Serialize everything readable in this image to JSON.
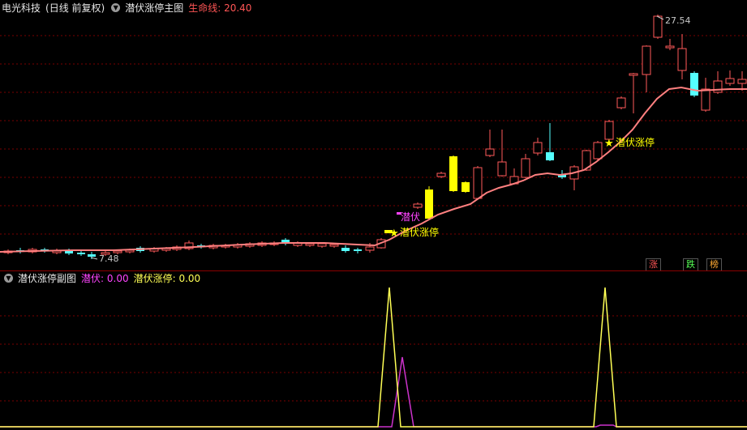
{
  "main": {
    "stock_name": "电光科技",
    "period_label": "(日线 前复权)",
    "indicator_name": "潜伏涨停主图",
    "life_line_label": "生命线: 20.40",
    "high_label": "27.54",
    "low_label": "7.48",
    "signal_qianfu": "潜伏",
    "signal_zhangting_1": "潜伏涨停",
    "signal_zhangting_2": "潜伏涨停",
    "tags": [
      "涨",
      "跌",
      "榜"
    ],
    "colors": {
      "up": "#ff5a5a",
      "down": "#54ffff",
      "signal": "#ffff00",
      "line": "#ff8080",
      "grid": "#7a0000"
    }
  },
  "sub": {
    "indicator_name": "潜伏涨停副图",
    "qianfu_label": "潜伏: 0.00",
    "zhangting_label": "潜伏涨停: 0.00"
  }
}
